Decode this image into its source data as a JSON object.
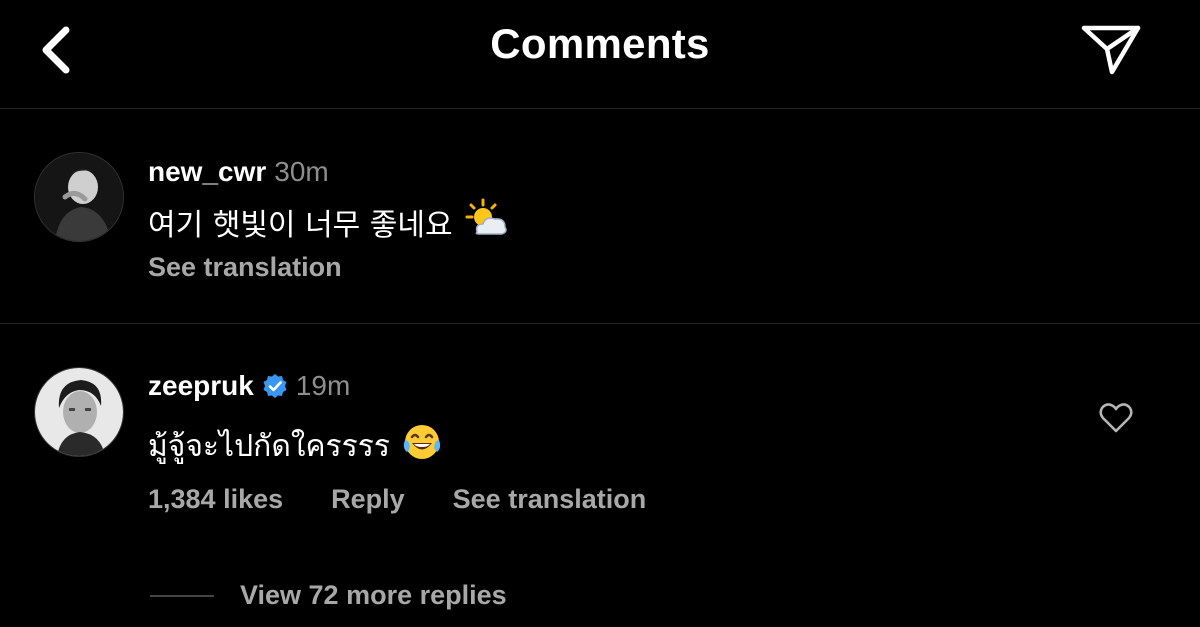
{
  "header": {
    "title": "Comments",
    "back_icon": "chevron-left-icon",
    "share_icon": "paper-plane-icon"
  },
  "comments": [
    {
      "username": "new_cwr",
      "time": "30m",
      "text": "여기 햇빛이 너무 좋네요",
      "emoji": "⛅",
      "emoji_name": "sun-behind-cloud-icon",
      "actions": {
        "see_translation": "See translation"
      }
    },
    {
      "username": "zeepruk",
      "verified": true,
      "time": "19m",
      "text": "มู้จู้จะไปกัดใครรรร",
      "emoji": "😂",
      "emoji_name": "tears-of-joy-icon",
      "actions": {
        "likes": "1,384 likes",
        "reply": "Reply",
        "see_translation": "See translation"
      },
      "view_replies": "View 72 more replies"
    }
  ],
  "colors": {
    "background": "#000000",
    "primary_text": "#ffffff",
    "secondary_text": "#8e8e8e",
    "action_text": "#a8a8a8",
    "divider": "#262626",
    "verified_blue": "#3897f0"
  }
}
